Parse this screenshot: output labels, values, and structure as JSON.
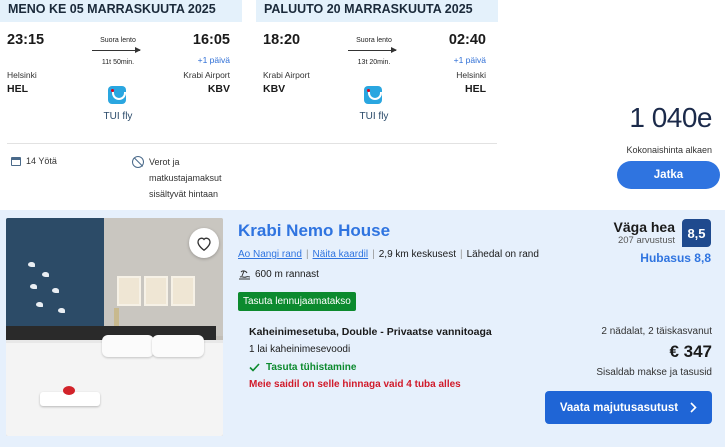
{
  "outbound": {
    "header": "MENO KE 05 MARRASKUUTA 2025",
    "depart_time": "23:15",
    "arrive_time": "16:05",
    "direct_label": "Suora lento",
    "duration": "11t 50min.",
    "day_offset": "+1 päivä",
    "from_city": "Helsinki",
    "from_code": "HEL",
    "to_city": "Krabi Airport",
    "to_code": "KBV",
    "airline": "TUI fly"
  },
  "return": {
    "header": "PALUUTO 20 MARRASKUUTA 2025",
    "depart_time": "18:20",
    "arrive_time": "02:40",
    "direct_label": "Suora lento",
    "duration": "13t 20min.",
    "day_offset": "+1 päivä",
    "from_city": "Krabi Airport",
    "from_code": "KBV",
    "to_city": "Helsinki",
    "to_code": "HEL",
    "airline": "TUI fly"
  },
  "trip": {
    "nights": "14 Yötä",
    "taxes_note": "Verot ja matkustajamaksut sisältyvät hintaan"
  },
  "summary": {
    "total_price": "1 040e",
    "price_label": "Kokonaishinta alkaen",
    "continue_label": "Jatka"
  },
  "hotel": {
    "name": "Krabi Nemo House",
    "location_link": "Ao Nangi rand",
    "map_link": "Näita kaardil",
    "distance": "2,9 km keskusest",
    "near_beach": "Lähedal on rand",
    "beach_distance": "600 m rannast",
    "badge": "Tasuta lennujaamatakso",
    "rating_word": "Väga hea",
    "reviews": "207 arvustust",
    "score": "8,5",
    "value_score": "Hubasus 8,8",
    "room_title": "Kaheinimesetuba, Double - Privaatse vannitoaga",
    "bed_type": "1 lai kaheinimesevoodi",
    "cancellation": "Tasuta tühistamine",
    "scarcity": "Meie saidil on selle hinnaga vaid 4 tuba alles",
    "stay_info": "2 nädalat, 2 täiskasvanut",
    "price": "€ 347",
    "price_note": "Sisaldab makse ja tasusid",
    "cta_label": "Vaata majutusasutust"
  },
  "colors": {
    "accent_blue": "#2f74e0",
    "score_navy": "#1f4a8e",
    "free_green": "#0c8a2e",
    "alert_red": "#d11a2a",
    "header_bg": "#e4f1fb",
    "card_bg": "#e6f0fc"
  },
  "icons": [
    "calendar-icon",
    "no-fee-icon",
    "tui-logo",
    "beach-icon",
    "heart-icon",
    "check-icon",
    "chevron-right-icon"
  ]
}
